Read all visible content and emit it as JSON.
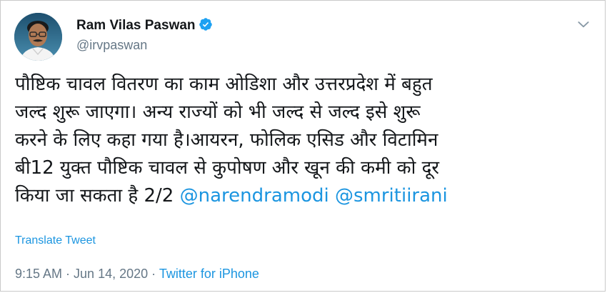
{
  "author": {
    "name": "Ram Vilas Paswan",
    "handle": "@irvpaswan",
    "verified": true
  },
  "tweet": {
    "text_lines": [
      "पौष्टिक चावल वितरण का काम ओडिशा और उत्तरप्रदेश में बहुत",
      "जल्द शुरू जाएगा। अन्य राज्यों को भी जल्द से जल्द इसे शुरू",
      "करने के लिए कहा गया है।आयरन, फोलिक एसिड और विटामिन",
      "बी12 युक्त पौष्टिक चावल से कुपोषण और खून की कमी को दूर"
    ],
    "last_line_text": "किया जा सकता है 2/2",
    "mentions": [
      "@narendramodi",
      "@smritiirani"
    ]
  },
  "translate_label": "Translate Tweet",
  "meta": {
    "time": "9:15 AM",
    "separator": " · ",
    "date": "Jun 14, 2020",
    "source": "Twitter for iPhone"
  },
  "icons": {
    "verified": "verified-badge-icon",
    "menu": "chevron-down-icon"
  },
  "colors": {
    "link": "#1b95e0",
    "verified": "#1da1f2",
    "text": "#14171a",
    "secondary": "#657786"
  }
}
